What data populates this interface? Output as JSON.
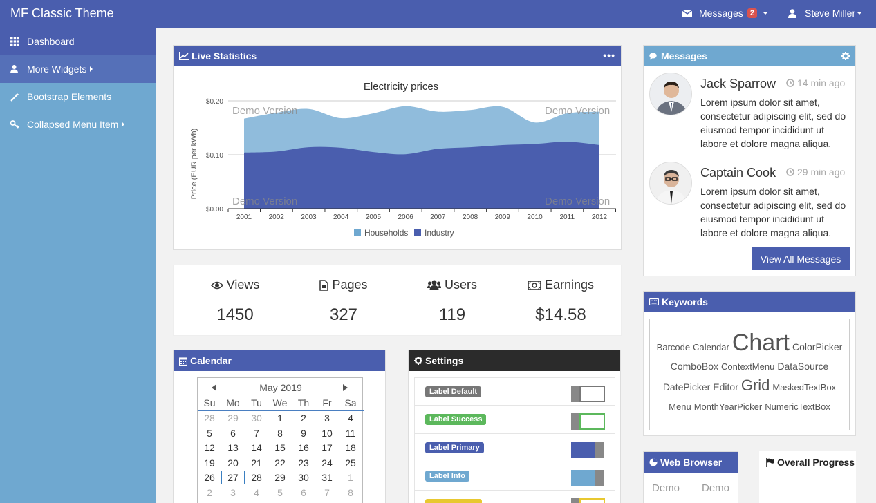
{
  "app": {
    "title": "MF Classic Theme",
    "messages_label": "Messages",
    "messages_count": "2",
    "user_name": "Steve Miller"
  },
  "sidebar": {
    "items": [
      {
        "label": "Dashboard",
        "icon": "grid-icon"
      },
      {
        "label": "More Widgets",
        "icon": "user-icon"
      },
      {
        "label": "Bootstrap Elements",
        "icon": "magic-wand-icon"
      },
      {
        "label": "Collapsed Menu Item",
        "icon": "key-icon"
      }
    ]
  },
  "live_statistics": {
    "title": "Live Statistics"
  },
  "chart_data": {
    "type": "area",
    "title": "Electricity prices",
    "ylabel": "Price (EUR per kWh)",
    "xlabel": "",
    "x": [
      "2001",
      "2002",
      "2003",
      "2004",
      "2005",
      "2006",
      "2007",
      "2008",
      "2009",
      "2010",
      "2011",
      "2012"
    ],
    "ylim": [
      0,
      0.2
    ],
    "yticks": [
      "$0.00",
      "$0.10",
      "$0.20"
    ],
    "stacked": true,
    "series": [
      {
        "name": "Households",
        "color": "#8ab8da",
        "values": [
          0.167,
          0.178,
          0.185,
          0.168,
          0.177,
          0.19,
          0.18,
          0.183,
          0.189,
          0.16,
          0.177,
          0.18
        ]
      },
      {
        "name": "Industry",
        "color": "#4a5eae",
        "values": [
          0.104,
          0.106,
          0.114,
          0.113,
          0.105,
          0.101,
          0.111,
          0.114,
          0.118,
          0.12,
          0.124,
          0.118
        ]
      }
    ],
    "legend": "bottom",
    "watermark": "Demo Version",
    "grid": true
  },
  "stats": [
    {
      "label": "Views",
      "value": "1450",
      "icon": "eye-icon"
    },
    {
      "label": "Pages",
      "value": "327",
      "icon": "file-icon"
    },
    {
      "label": "Users",
      "value": "119",
      "icon": "users-icon"
    },
    {
      "label": "Earnings",
      "value": "$14.58",
      "icon": "money-icon"
    }
  ],
  "calendar": {
    "title": "Calendar",
    "month": "May 2019",
    "days_of_week": [
      "Su",
      "Mo",
      "Tu",
      "We",
      "Th",
      "Fr",
      "Sa"
    ],
    "weeks": [
      [
        "28",
        "29",
        "30",
        "1",
        "2",
        "3",
        "4"
      ],
      [
        "5",
        "6",
        "7",
        "8",
        "9",
        "10",
        "11"
      ],
      [
        "12",
        "13",
        "14",
        "15",
        "16",
        "17",
        "18"
      ],
      [
        "19",
        "20",
        "21",
        "22",
        "23",
        "24",
        "25"
      ],
      [
        "26",
        "27",
        "28",
        "29",
        "30",
        "31",
        "1"
      ],
      [
        "2",
        "3",
        "4",
        "5",
        "6",
        "7",
        "8"
      ]
    ],
    "selected": "27"
  },
  "settings": {
    "title": "Settings",
    "rows": [
      {
        "label": "Label Default",
        "color": "#777777",
        "state": "off"
      },
      {
        "label": "Label Success",
        "color": "#5cb85c",
        "state": "off"
      },
      {
        "label": "Label Primary",
        "color": "#4a5eae",
        "state": "on"
      },
      {
        "label": "Label Info",
        "color": "#6fa8d0",
        "state": "on"
      },
      {
        "label": "",
        "color": "#e8c830",
        "state": "off"
      }
    ]
  },
  "messages": {
    "title": "Messages",
    "items": [
      {
        "name": "Jack Sparrow",
        "time": "14 min ago",
        "text": "Lorem ipsum dolor sit amet, consectetur adipiscing elit, sed do eiusmod tempor incididunt ut labore et dolore magna aliqua."
      },
      {
        "name": "Captain Cook",
        "time": "29 min ago",
        "text": "Lorem ipsum dolor sit amet, consectetur adipiscing elit, sed do eiusmod tempor incididunt ut labore et dolore magna aliqua."
      }
    ],
    "view_all": "View All Messages"
  },
  "keywords": {
    "title": "Keywords",
    "items": [
      {
        "text": "Barcode",
        "size": "small"
      },
      {
        "text": "Calendar",
        "size": "small"
      },
      {
        "text": "Chart",
        "size": "large"
      },
      {
        "text": "ColorPicker",
        "size": "medium"
      },
      {
        "text": "ComboBox",
        "size": "medium"
      },
      {
        "text": "ContextMenu",
        "size": "small"
      },
      {
        "text": "DataSource",
        "size": "medium"
      },
      {
        "text": "DatePicker",
        "size": "medium"
      },
      {
        "text": "Editor",
        "size": "medium"
      },
      {
        "text": "Grid",
        "size": "xl"
      },
      {
        "text": "MaskedTextBox",
        "size": "small"
      },
      {
        "text": "Menu",
        "size": "small"
      },
      {
        "text": "MonthYearPicker",
        "size": "small"
      },
      {
        "text": "NumericTextBox",
        "size": "small"
      }
    ]
  },
  "web_browser": {
    "title": "Web Browser",
    "demo_left": "Demo",
    "demo_right": "Demo"
  },
  "overall_progress": {
    "title": "Overall Progress"
  }
}
